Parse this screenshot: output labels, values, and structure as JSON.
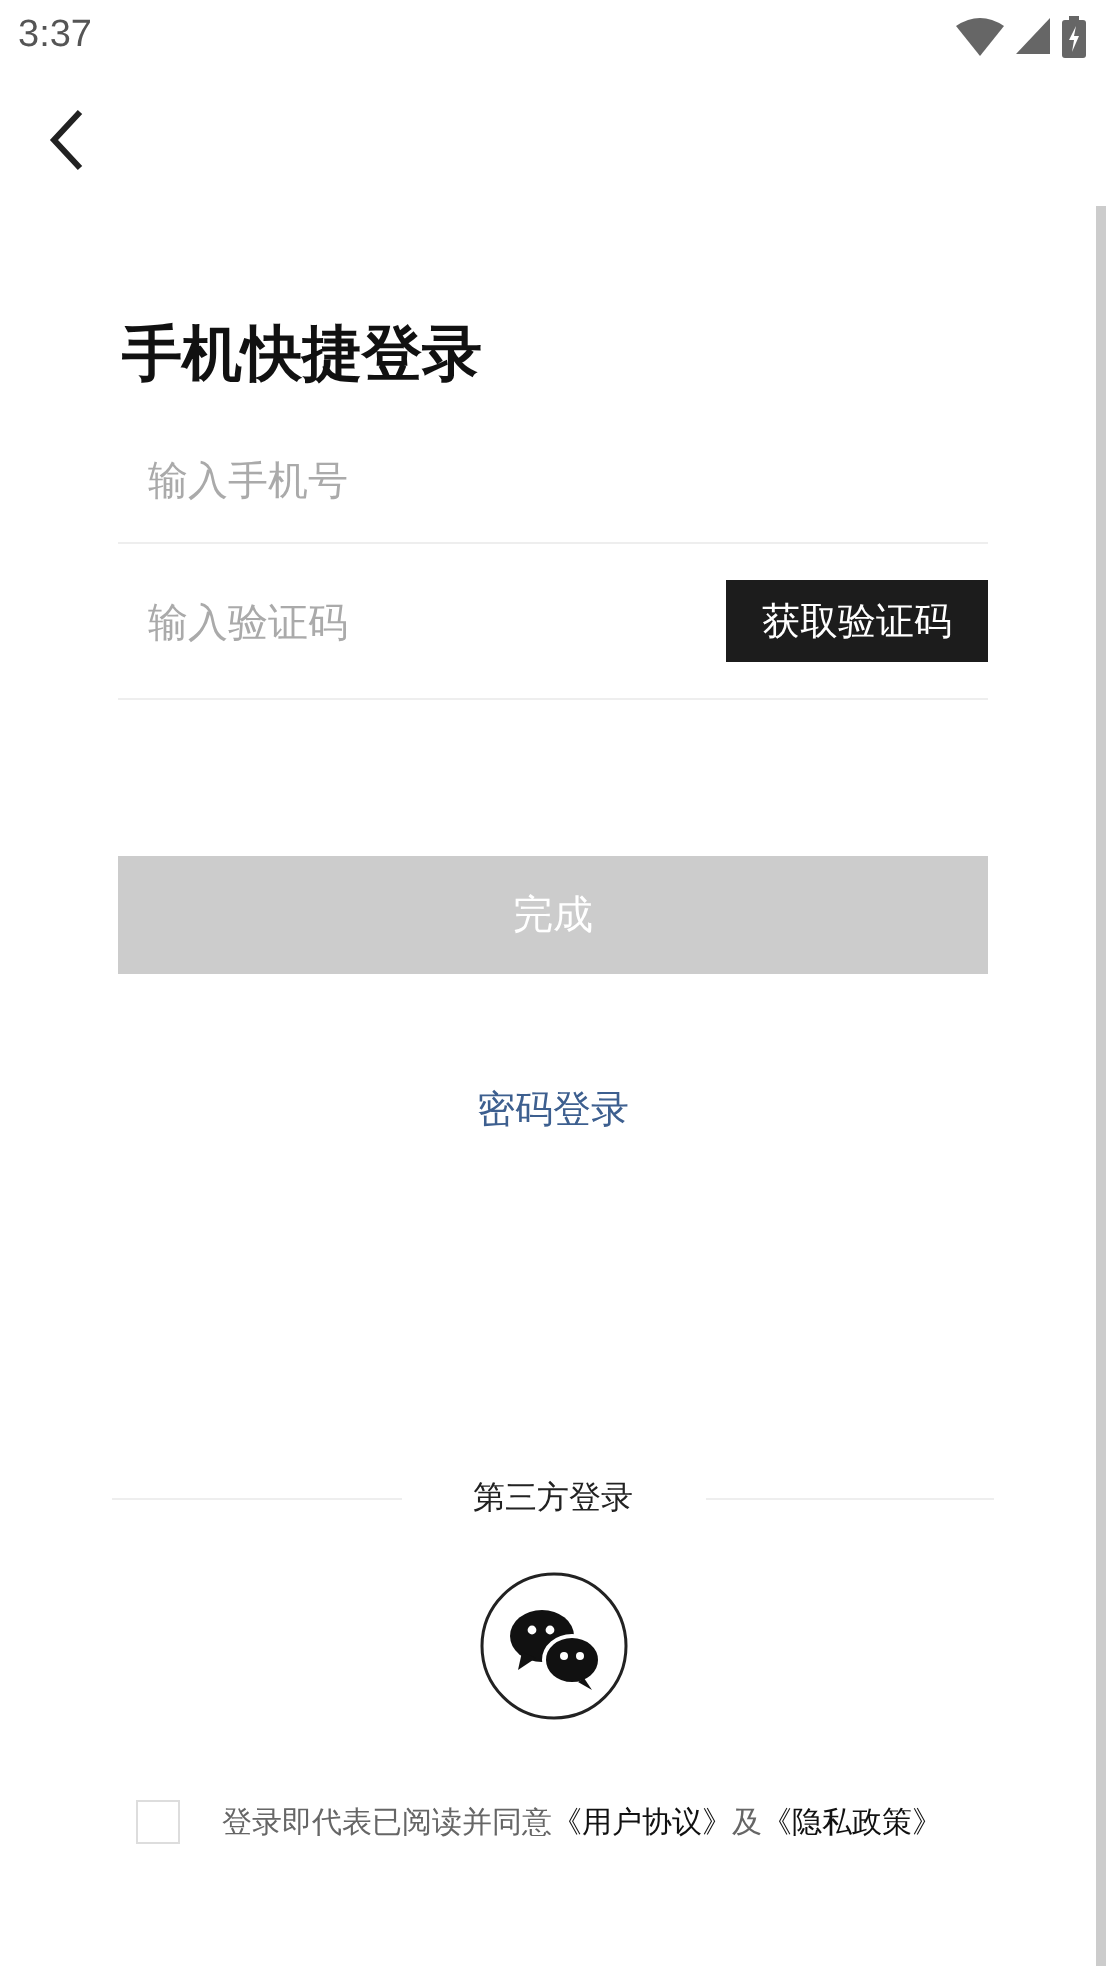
{
  "status_bar": {
    "time": "3:37"
  },
  "title": "手机快捷登录",
  "phone_field": {
    "placeholder": "输入手机号"
  },
  "code_field": {
    "placeholder": "输入验证码"
  },
  "get_code_button": "获取验证码",
  "submit_button": {
    "label": "完成",
    "disabled": true
  },
  "password_login_link": "密码登录",
  "third_party_label": "第三方登录",
  "agreement": {
    "checked": false,
    "parts": [
      {
        "kind": "text",
        "text": "登录即代表已阅读并同意"
      },
      {
        "kind": "link",
        "text": "《用户协议》"
      },
      {
        "kind": "text",
        "text": "及"
      },
      {
        "kind": "link",
        "text": "《隐私政策》"
      }
    ]
  }
}
